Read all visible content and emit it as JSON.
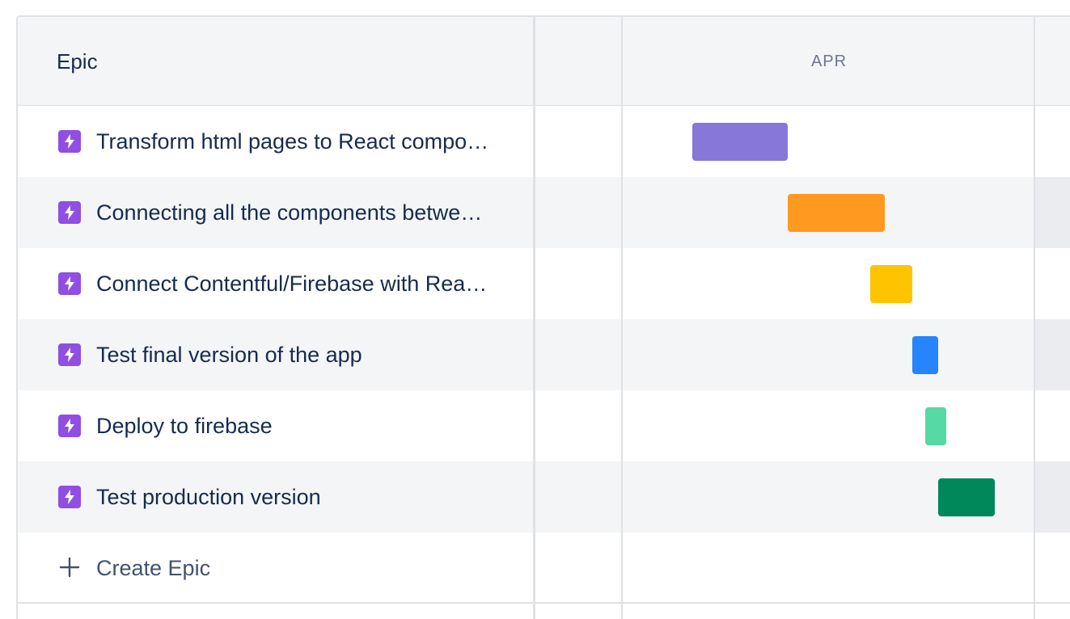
{
  "header": {
    "epic_label": "Epic",
    "month_label": "APR"
  },
  "epics": [
    {
      "title": "Transform html pages to React compo…",
      "color": "#8777d9",
      "icon": "lightning-icon"
    },
    {
      "title": "Connecting all the components betwe…",
      "color": "#ff991f",
      "icon": "lightning-icon"
    },
    {
      "title": "Connect Contentful/Firebase with Rea…",
      "color": "#ffc400",
      "icon": "lightning-icon"
    },
    {
      "title": "Test final version of the app",
      "color": "#2684ff",
      "icon": "lightning-icon"
    },
    {
      "title": "Deploy to firebase",
      "color": "#57d9a3",
      "icon": "lightning-icon"
    },
    {
      "title": "Test production version",
      "color": "#00875a",
      "icon": "lightning-icon"
    }
  ],
  "create": {
    "label": "Create Epic",
    "icon": "plus-icon"
  },
  "colors": {
    "epic_icon": "#904ee2",
    "header_bg": "#f4f5f7",
    "grid": "#dfe1e6"
  }
}
